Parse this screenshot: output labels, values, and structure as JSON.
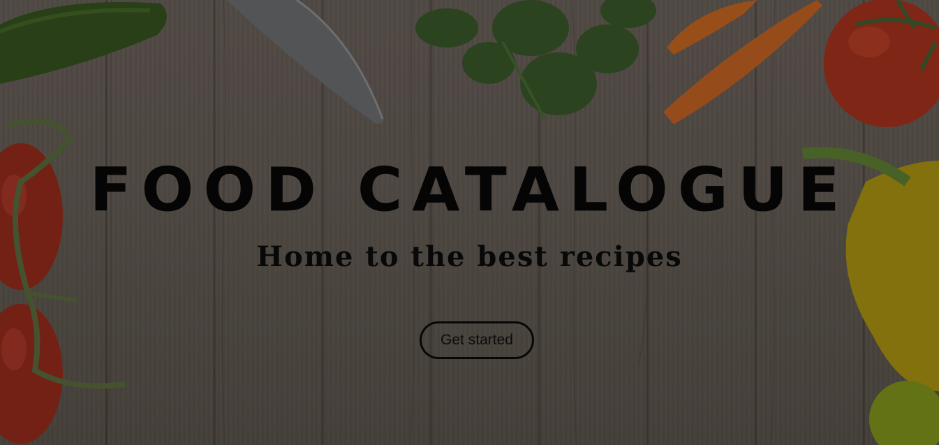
{
  "hero": {
    "title": "FOOD CATALOGUE",
    "subtitle": "Home to the best recipes",
    "cta_label": "Get started"
  },
  "background": {
    "icons": [
      "cucumber-icon",
      "knife-icon",
      "parsley-icon",
      "carrot-icon",
      "tomato-icon",
      "cherry-tomatoes-icon",
      "bell-pepper-icon"
    ],
    "colors": {
      "wood": "#544d47",
      "tomato": "#8a2a1a",
      "carrot": "#a5551c",
      "parsley": "#2f4a22",
      "pepper": "#8f7b10",
      "cucumber": "#2c4519"
    }
  }
}
